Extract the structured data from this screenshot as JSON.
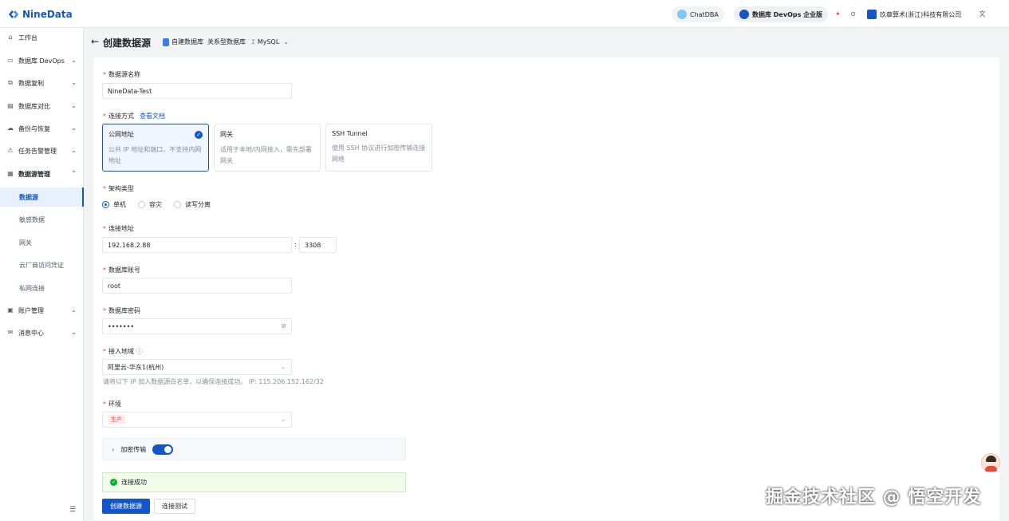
{
  "app": {
    "logo_text": "NineData"
  },
  "topbar": {
    "chatdba": "ChatDBA",
    "edition": "数据库 DevOps 企业版",
    "org": "玖章算术(浙江)科技有限公司"
  },
  "sidebar": {
    "items": [
      {
        "label": "工作台"
      },
      {
        "label": "数据库 DevOps"
      },
      {
        "label": "数据复制"
      },
      {
        "label": "数据库对比"
      },
      {
        "label": "备份与恢复"
      },
      {
        "label": "任务告警管理"
      },
      {
        "label": "数据源管理"
      },
      {
        "label": "账户管理"
      },
      {
        "label": "消息中心"
      }
    ],
    "sub_items": [
      {
        "label": "数据源"
      },
      {
        "label": "敏感数据"
      },
      {
        "label": "网关"
      },
      {
        "label": "云厂商访问凭证"
      },
      {
        "label": "私网连接"
      }
    ]
  },
  "header": {
    "title": "创建数据源",
    "crumb1": "自建数据库",
    "crumb2": "关系型数据库",
    "crumb3": "MySQL"
  },
  "form": {
    "name_label": "数据源名称",
    "name_value": "NineData-Test",
    "conn_label": "连接方式",
    "conn_doc_link": "查看文档",
    "conn_options": [
      {
        "title": "公网地址",
        "desc": "公共 IP 地址和端口，不支持内网地址"
      },
      {
        "title": "网关",
        "desc": "适用于本地/内网接入，需先部署网关"
      },
      {
        "title": "SSH Tunnel",
        "desc": "使用 SSH 协议进行加密传输连接网络"
      }
    ],
    "arch_label": "架构类型",
    "arch_options": [
      "单机",
      "容灾",
      "读写分离"
    ],
    "addr_label": "连接地址",
    "host_value": "192.168.2.88",
    "port_sep": ":",
    "port_value": "3308",
    "account_label": "数据库账号",
    "account_value": "root",
    "password_label": "数据库密码",
    "password_value": "•••••••",
    "region_label": "接入地域",
    "region_value": "阿里云-华东1(杭州)",
    "region_hint": "请将以下 IP 加入数据源白名单，以确保连接成功。 IP: 115.206.152.162/32",
    "env_label": "环境",
    "env_value": "生产",
    "encrypt_label": "加密传输",
    "success_text": "连接成功",
    "create_button": "创建数据源",
    "test_button": "连接测试"
  },
  "watermark": "掘金技术社区 @ 悟空开发",
  "colors": {
    "primary": "#1456c8",
    "required": "#f53f3f",
    "success": "#00b42a"
  }
}
